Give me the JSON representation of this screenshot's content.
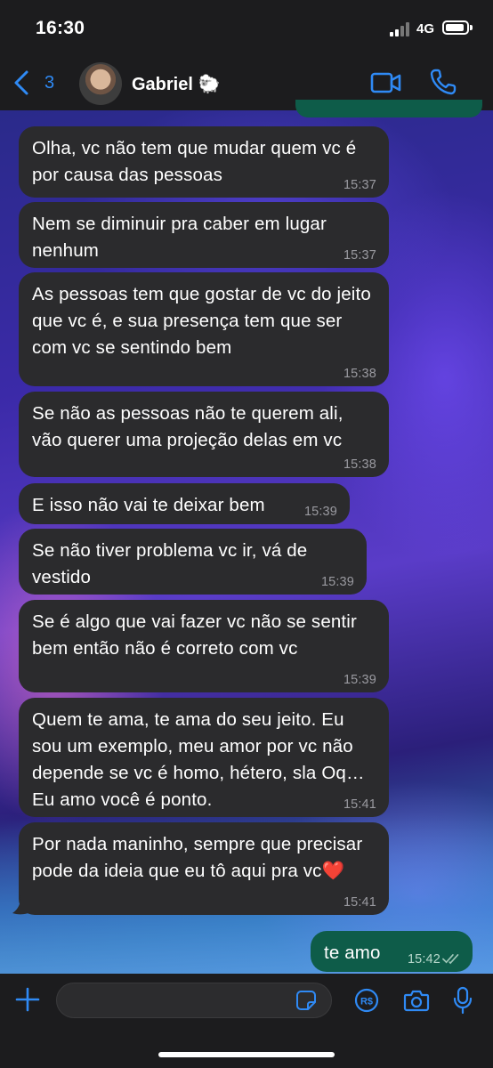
{
  "status_bar": {
    "time": "16:30",
    "network": "4G"
  },
  "header": {
    "back_count": "3",
    "contact_name": "Gabriel 🐑"
  },
  "messages": [
    {
      "text": "Olha, vc não tem que mudar quem vc é por causa das pessoas",
      "time": "15:37",
      "direction": "in"
    },
    {
      "text": "Nem se diminuir pra caber em lugar nenhum",
      "time": "15:37",
      "direction": "in"
    },
    {
      "text": "As pessoas tem que gostar de vc do jeito que vc é, e sua presença tem que ser com vc se sentindo bem",
      "time": "15:38",
      "direction": "in"
    },
    {
      "text": "Se não as pessoas não te querem ali, vão querer uma projeção delas em vc",
      "time": "15:38",
      "direction": "in"
    },
    {
      "text": "E isso não vai te deixar bem",
      "time": "15:39",
      "direction": "in"
    },
    {
      "text": "Se não tiver problema vc ir, vá de vestido",
      "time": "15:39",
      "direction": "in"
    },
    {
      "text": "Se é algo que vai fazer vc não se sentir bem então não é correto com vc",
      "time": "15:39",
      "direction": "in"
    },
    {
      "text": "Quem te ama, te ama do seu jeito. Eu sou um exemplo, meu amor por vc não depende se vc é homo, hétero, sla Oq… Eu amo você é ponto.",
      "time": "15:41",
      "direction": "in"
    },
    {
      "text": "Por nada maninho, sempre que precisar pode da ideia que eu tô aqui pra vc❤️",
      "time": "15:41",
      "direction": "in"
    },
    {
      "text": "te amo",
      "time": "15:42",
      "direction": "out",
      "status": "read"
    }
  ],
  "input": {
    "placeholder": ""
  },
  "icons": {
    "back": "chevron-left-icon",
    "video": "video-camera-icon",
    "call": "phone-icon",
    "plus": "plus-icon",
    "sticker": "sticker-icon",
    "pay": "payment-icon",
    "camera": "camera-icon",
    "mic": "microphone-icon"
  },
  "colors": {
    "accent": "#2f8af5",
    "incoming_bubble": "#2b2b2d",
    "outgoing_bubble": "#0e5c49",
    "bar": "#1c1c1e"
  }
}
